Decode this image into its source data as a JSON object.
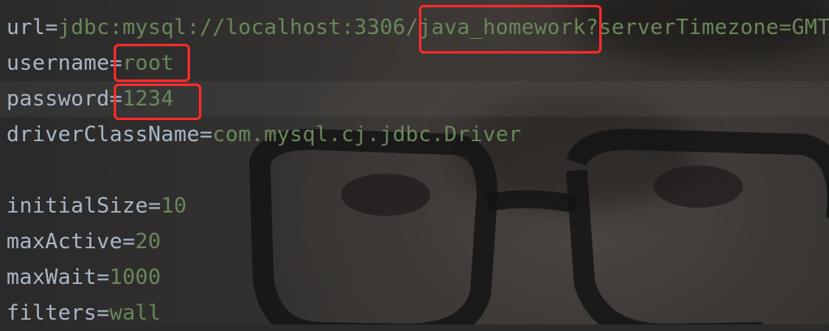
{
  "properties": [
    {
      "key": "url",
      "value": "jdbc:mysql://localhost:3306/java_homework?serverTimezone=GMT"
    },
    {
      "key": "username",
      "value": "root"
    },
    {
      "key": "password",
      "value": "1234"
    },
    {
      "key": "driverClassName",
      "value": "com.mysql.cj.jdbc.Driver"
    },
    {
      "key": "",
      "value": ""
    },
    {
      "key": "initialSize",
      "value": "10"
    },
    {
      "key": "maxActive",
      "value": "20"
    },
    {
      "key": "maxWait",
      "value": "1000"
    },
    {
      "key": "filters",
      "value": "wall"
    }
  ],
  "separator": "=",
  "colors": {
    "key": "#a9b7c6",
    "value": "#6a8759",
    "highlight_box": "#ff2a2a",
    "background": "#2b2b2b"
  }
}
